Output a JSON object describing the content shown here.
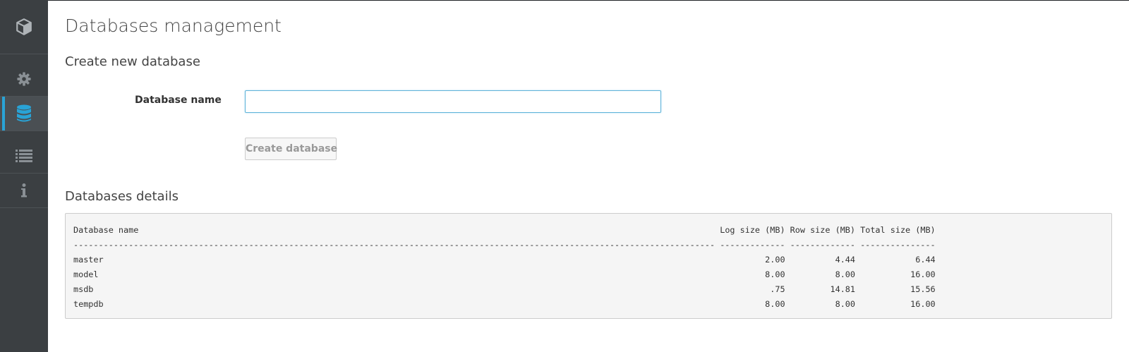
{
  "sidebar": {
    "logo_icon": "cube-icon",
    "items": [
      {
        "name": "settings",
        "icon": "gear-icon",
        "active": false
      },
      {
        "name": "databases",
        "icon": "database-icon",
        "active": true
      },
      {
        "name": "list",
        "icon": "list-icon",
        "active": false
      },
      {
        "name": "info",
        "icon": "info-icon",
        "active": false
      }
    ],
    "accent_color": "#29a3d6"
  },
  "page_title": "Databases management",
  "create": {
    "heading": "Create new database",
    "field_label": "Database name",
    "field_value": "",
    "button_label": "Create database"
  },
  "details": {
    "heading": "Databases details",
    "columns": [
      "Database name",
      "Log size (MB)",
      "Row size (MB)",
      "Total size (MB)"
    ],
    "rows": [
      [
        "master",
        "2.00",
        "4.44",
        "6.44"
      ],
      [
        "model",
        "8.00",
        "8.00",
        "16.00"
      ],
      [
        "msdb",
        ".75",
        "14.81",
        "15.56"
      ],
      [
        "tempdb",
        "8.00",
        "8.00",
        "16.00"
      ]
    ]
  }
}
